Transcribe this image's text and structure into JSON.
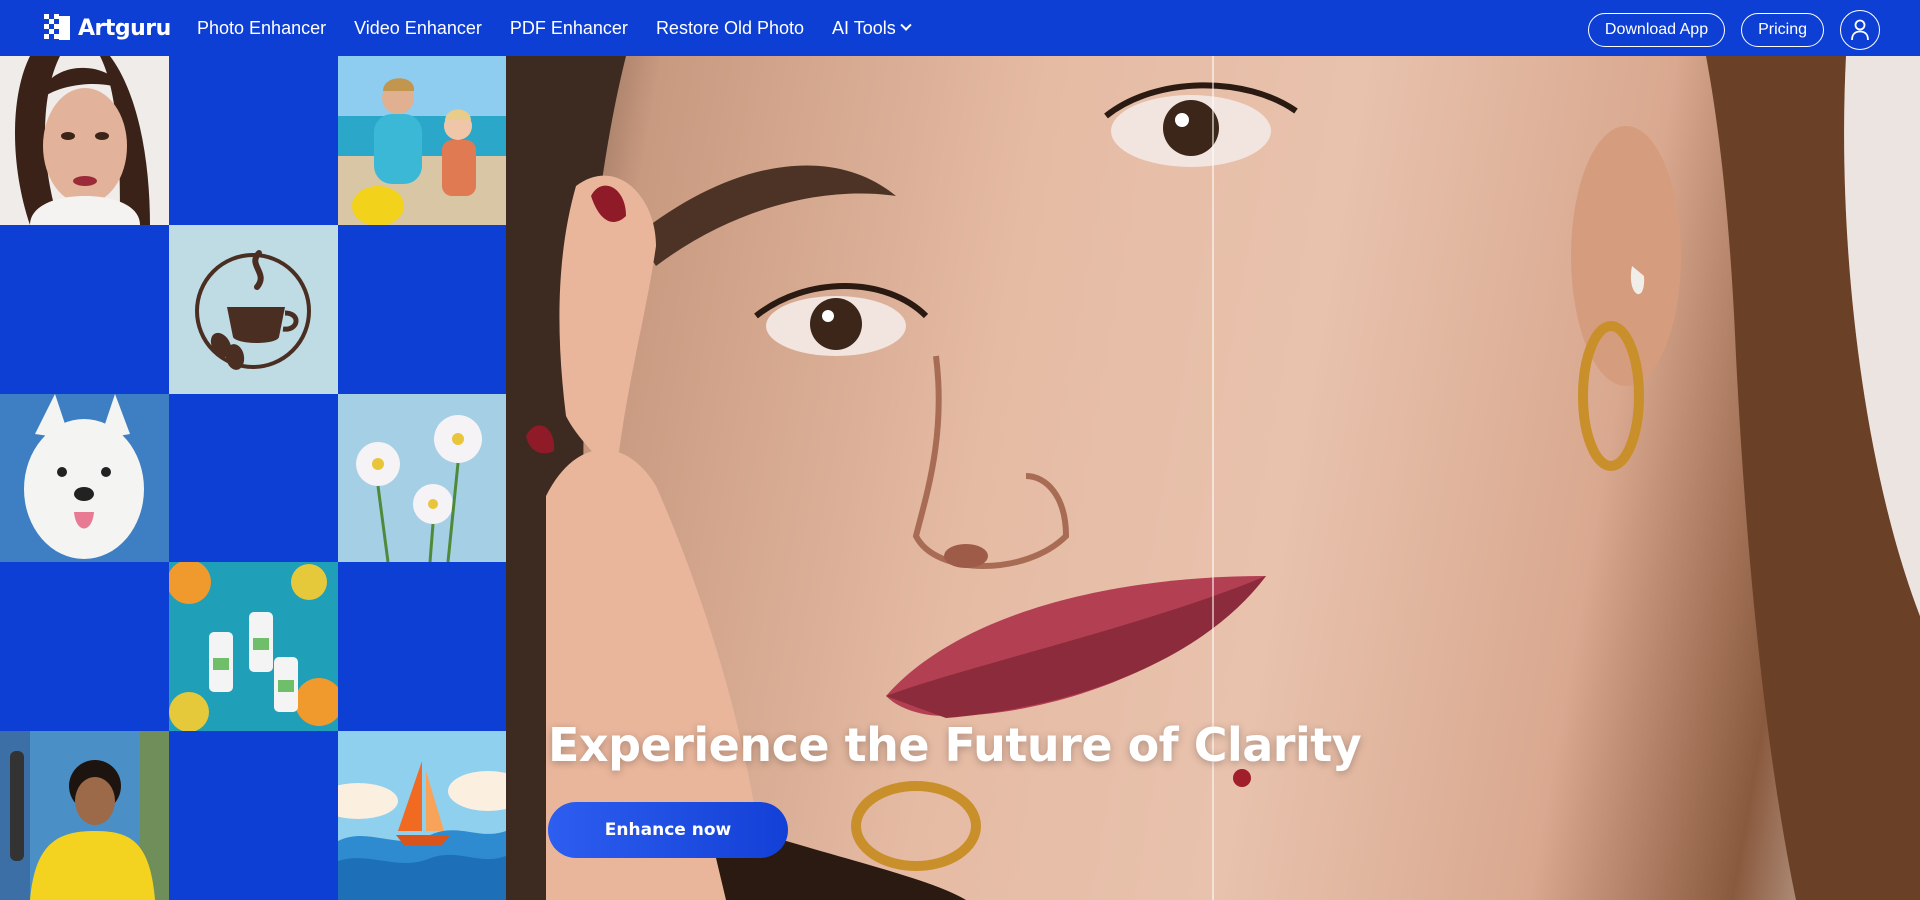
{
  "brand": {
    "name": "Artguru"
  },
  "nav": {
    "items": [
      {
        "label": "Photo Enhancer"
      },
      {
        "label": "Video Enhancer"
      },
      {
        "label": "PDF Enhancer"
      },
      {
        "label": "Restore Old Photo"
      },
      {
        "label": "AI Tools"
      }
    ],
    "download_label": "Download App",
    "pricing_label": "Pricing"
  },
  "hero": {
    "title": "Experience the Future of Clarity",
    "cta_label": "Enhance now"
  },
  "colors": {
    "brand_blue": "#0d3fd4",
    "white": "#ffffff"
  }
}
